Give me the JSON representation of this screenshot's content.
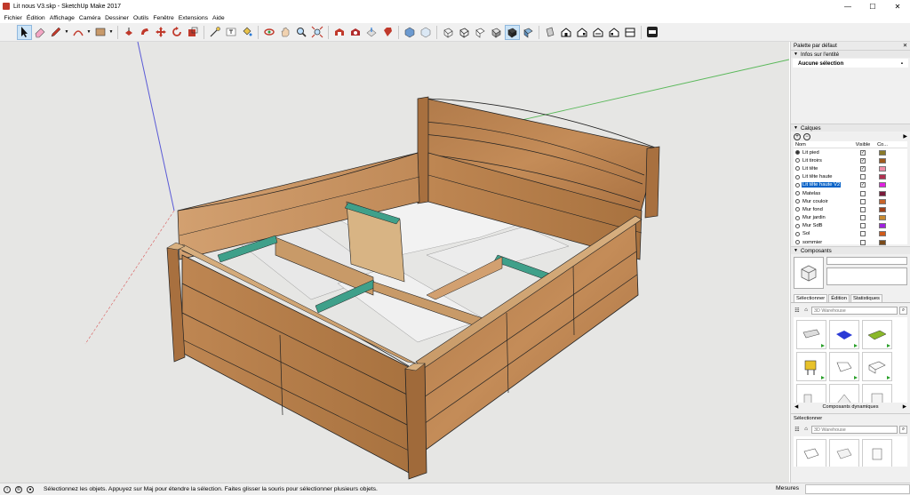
{
  "window": {
    "title": "Lit nous V3.skp - SketchUp Make 2017",
    "minimize_label": "—",
    "maximize_label": "☐",
    "close_label": "✕"
  },
  "menu": {
    "items": [
      "Fichier",
      "Édition",
      "Affichage",
      "Caméra",
      "Dessiner",
      "Outils",
      "Fenêtre",
      "Extensions",
      "Aide"
    ]
  },
  "toolbar": {
    "tools": [
      {
        "name": "select-tool",
        "icon": "arrow-cursor-icon",
        "active": true
      },
      {
        "name": "eraser-tool",
        "icon": "eraser-icon"
      },
      {
        "name": "line-tool",
        "icon": "pencil-icon",
        "dropdown": true
      },
      {
        "name": "arc-tool",
        "icon": "arc-icon",
        "dropdown": true
      },
      {
        "name": "shape-tool",
        "icon": "rectangle-icon",
        "dropdown": true
      },
      {
        "name": "push-pull-tool",
        "icon": "push-pull-icon"
      },
      {
        "name": "follow-me-tool",
        "icon": "follow-me-icon"
      },
      {
        "name": "move-tool",
        "icon": "move-icon"
      },
      {
        "name": "rotate-tool",
        "icon": "rotate-icon"
      },
      {
        "name": "scale-tool",
        "icon": "scale-icon"
      },
      {
        "name": "tape-tool",
        "icon": "tape-measure-icon"
      },
      {
        "name": "text-tool",
        "icon": "text-icon"
      },
      {
        "name": "paint-tool",
        "icon": "paint-bucket-icon"
      },
      {
        "name": "orbit-tool",
        "icon": "orbit-icon"
      },
      {
        "name": "pan-tool",
        "icon": "hand-icon"
      },
      {
        "name": "zoom-tool",
        "icon": "magnifier-icon"
      },
      {
        "name": "zoom-extents-tool",
        "icon": "zoom-extents-icon"
      },
      {
        "name": "warehouse-tool",
        "icon": "warehouse-icon"
      },
      {
        "name": "extension-warehouse-tool",
        "icon": "extension-warehouse-icon"
      },
      {
        "name": "share-model-tool",
        "icon": "share-model-icon"
      },
      {
        "name": "ruby-tool",
        "icon": "ruby-icon"
      },
      {
        "name": "view-iso",
        "icon": "iso-view-icon"
      },
      {
        "name": "view-xray",
        "icon": "xray-icon"
      },
      {
        "name": "style-backedges",
        "icon": "back-edges-icon"
      },
      {
        "name": "style-wireframe",
        "icon": "wireframe-icon"
      },
      {
        "name": "style-hidden",
        "icon": "hidden-line-icon"
      },
      {
        "name": "style-shaded",
        "icon": "shaded-icon"
      },
      {
        "name": "style-textured",
        "icon": "textured-icon"
      },
      {
        "name": "style-monochrome",
        "icon": "monochrome-icon"
      },
      {
        "name": "view-top",
        "icon": "top-view-icon"
      },
      {
        "name": "view-front",
        "icon": "front-view-icon"
      },
      {
        "name": "view-right",
        "icon": "right-view-icon"
      },
      {
        "name": "view-back",
        "icon": "back-view-icon"
      },
      {
        "name": "view-left",
        "icon": "left-view-icon"
      },
      {
        "name": "view-bottom",
        "icon": "bottom-view-icon"
      },
      {
        "name": "3d-warehouse-logo",
        "icon": "ocl-logo-icon"
      }
    ]
  },
  "panel": {
    "title": "Palette par défaut",
    "entity": {
      "title": "Infos sur l'entité",
      "selection": "Aucune sélection"
    },
    "layers": {
      "title": "Calques",
      "col_name": "Nom",
      "col_visible": "Visible",
      "col_color": "Co...",
      "rows": [
        {
          "name": "Lit pied",
          "current": true,
          "visible": true,
          "color": "#8a7a2a"
        },
        {
          "name": "Lit tiroirs",
          "current": false,
          "visible": true,
          "color": "#a05a1e"
        },
        {
          "name": "Lit tête",
          "current": false,
          "visible": true,
          "color": "#f08ca8"
        },
        {
          "name": "Lit tête haute",
          "current": false,
          "visible": false,
          "color": "#b03050"
        },
        {
          "name": "Lit tête haute V2",
          "current": false,
          "visible": true,
          "color": "#e020e0",
          "selected": true
        },
        {
          "name": "Matelas",
          "current": false,
          "visible": false,
          "color": "#7a1a3a"
        },
        {
          "name": "Mur couloir",
          "current": false,
          "visible": false,
          "color": "#c8642a"
        },
        {
          "name": "Mur fond",
          "current": false,
          "visible": false,
          "color": "#a0401a"
        },
        {
          "name": "Mur jardin",
          "current": false,
          "visible": false,
          "color": "#c88a30"
        },
        {
          "name": "Mur SdB",
          "current": false,
          "visible": false,
          "color": "#a020e0"
        },
        {
          "name": "Sol",
          "current": false,
          "visible": false,
          "color": "#d05a1a"
        },
        {
          "name": "sommier",
          "current": false,
          "visible": false,
          "color": "#7a4a1a"
        }
      ]
    },
    "components": {
      "title": "Composants",
      "tabs": [
        "Sélectionner",
        "Édition",
        "Statistiques"
      ],
      "search_placeholder": "3D Warehouse",
      "category": "Composants dynamiques",
      "select_label": "Sélectionner",
      "search_placeholder_2": "3D Warehouse"
    }
  },
  "status": {
    "message": "Sélectionnez les objets. Appuyez sur Maj pour étendre la sélection. Faites glisser la souris pour sélectionner plusieurs objets.",
    "measure_label": "Mesures"
  }
}
